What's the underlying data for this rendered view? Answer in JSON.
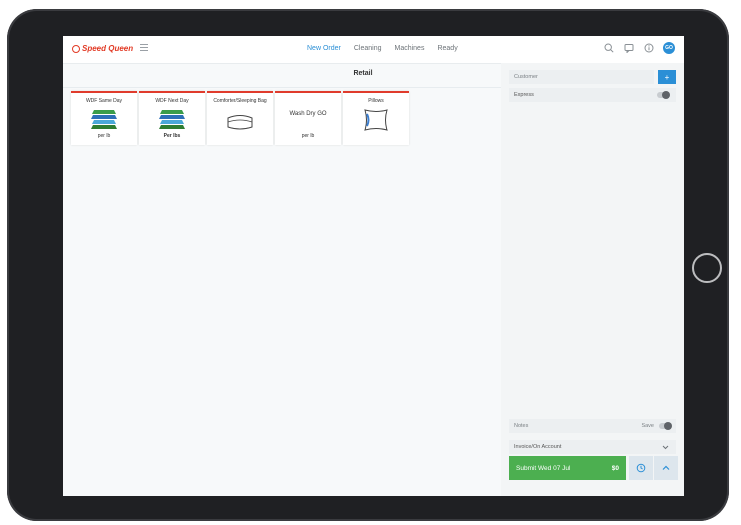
{
  "app": {
    "logo_text": "Speed Queen",
    "brand_color": "#e23a25",
    "accent_color": "#2b8fd6"
  },
  "nav": {
    "items": [
      "New Order",
      "Cleaning",
      "Machines",
      "Ready"
    ],
    "active": "New Order"
  },
  "header_icons": [
    "search-icon",
    "chat-icon",
    "info-icon"
  ],
  "user": {
    "initials": "GO"
  },
  "section": {
    "title": "Retail"
  },
  "cards": [
    {
      "title": "WDF Same Day",
      "subtitle": "per lb",
      "icon": "stacked-clothes-icon"
    },
    {
      "title": "WDF Next Day",
      "subtitle": "Per lbs",
      "icon": "stacked-clothes-icon"
    },
    {
      "title": "Comforter/Sleeping Bag",
      "subtitle": "",
      "icon": "comforter-icon"
    },
    {
      "title": "Wash Dry GO",
      "subtitle": "per lb",
      "icon": ""
    },
    {
      "title": "Pillows",
      "subtitle": "",
      "icon": "pillow-icon"
    }
  ],
  "panel": {
    "customer_placeholder": "Customer",
    "add_label": "+",
    "express_label": "Express",
    "notes_placeholder": "Notes",
    "save_label": "Save",
    "invoice_label": "Invoice/On Account",
    "submit_label": "Submit  Wed 07 Jul",
    "total": "$0",
    "submit_color": "#4caf50"
  }
}
